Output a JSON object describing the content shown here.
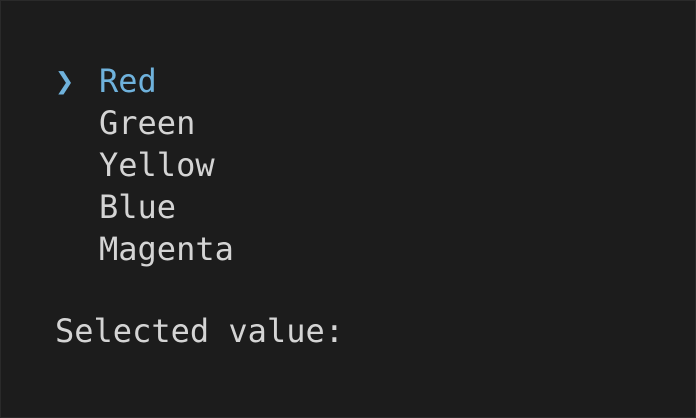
{
  "menu": {
    "pointer_glyph": "❯",
    "items": [
      {
        "label": "Red"
      },
      {
        "label": "Green"
      },
      {
        "label": "Yellow"
      },
      {
        "label": "Blue"
      },
      {
        "label": "Magenta"
      }
    ],
    "selected_index": 0
  },
  "status": {
    "label": "Selected value:"
  },
  "colors": {
    "background": "#1c1c1c",
    "text": "#d4d4d4",
    "accent": "#6fb2dc"
  }
}
